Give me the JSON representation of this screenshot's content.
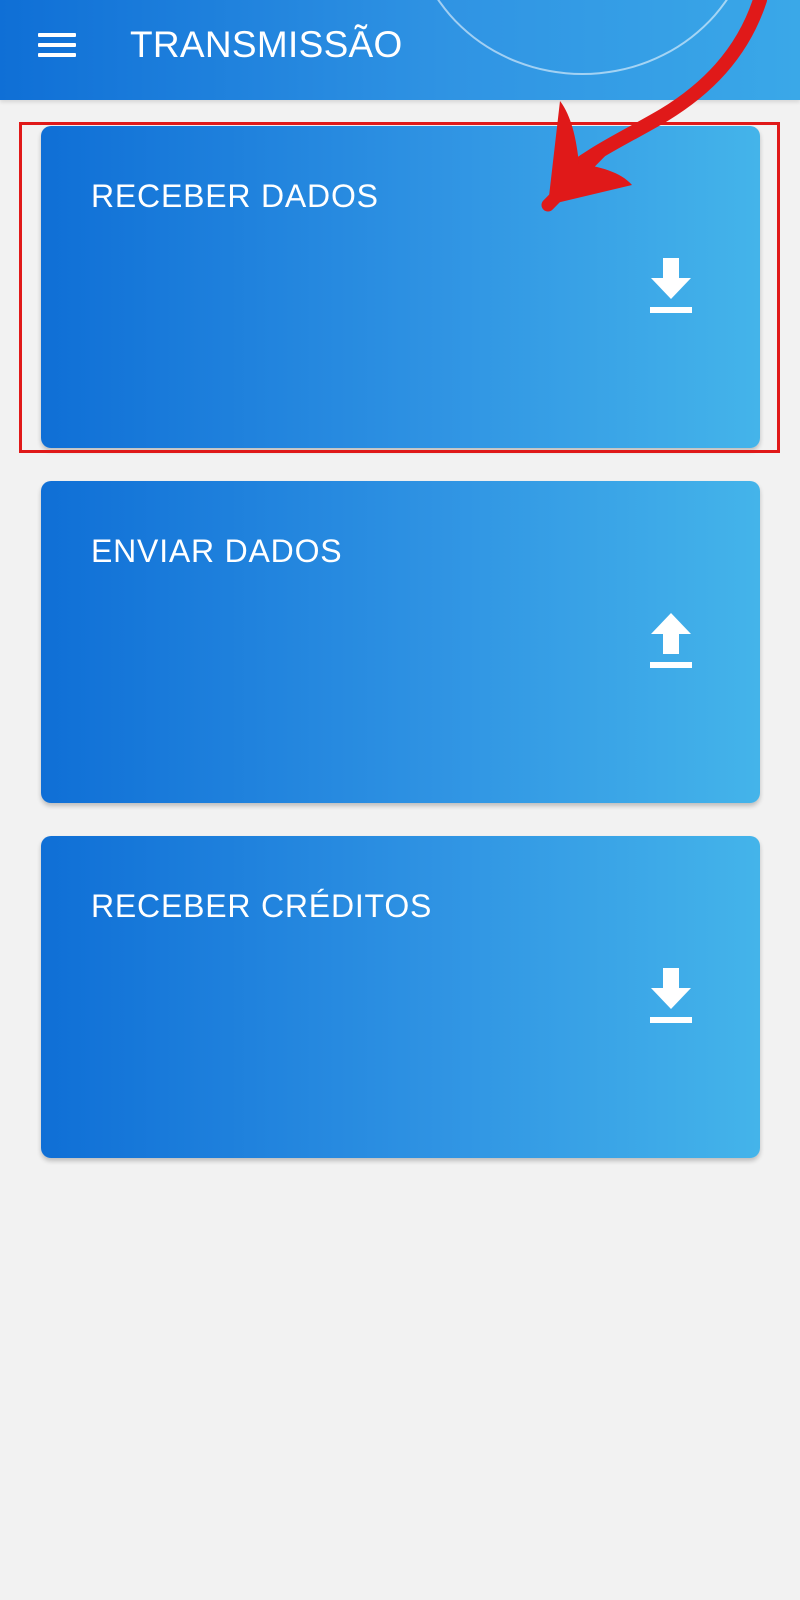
{
  "header": {
    "title": "TRANSMISSÃO",
    "menu_icon": "menu-icon"
  },
  "cards": [
    {
      "label": "RECEBER DADOS",
      "icon": "download-icon"
    },
    {
      "label": "ENVIAR DADOS",
      "icon": "upload-icon"
    },
    {
      "label": "RECEBER CRÉDITOS",
      "icon": "download-icon"
    }
  ],
  "annotation": {
    "highlight_color": "#e01919",
    "arrow_icon": "red-curved-arrow-icon"
  },
  "colors": {
    "primary_dark": "#0f6fd6",
    "primary_light": "#44b4ea",
    "background": "#f2f2f2"
  }
}
